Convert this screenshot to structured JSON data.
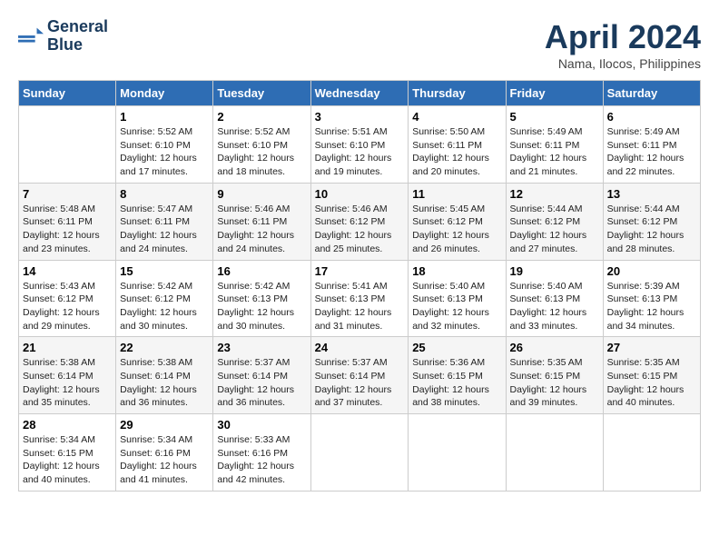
{
  "header": {
    "logo_line1": "General",
    "logo_line2": "Blue",
    "month_title": "April 2024",
    "location": "Nama, Ilocos, Philippines"
  },
  "days_of_week": [
    "Sunday",
    "Monday",
    "Tuesday",
    "Wednesday",
    "Thursday",
    "Friday",
    "Saturday"
  ],
  "weeks": [
    [
      {
        "num": "",
        "sunrise": "",
        "sunset": "",
        "daylight": ""
      },
      {
        "num": "1",
        "sunrise": "Sunrise: 5:52 AM",
        "sunset": "Sunset: 6:10 PM",
        "daylight": "Daylight: 12 hours and 17 minutes."
      },
      {
        "num": "2",
        "sunrise": "Sunrise: 5:52 AM",
        "sunset": "Sunset: 6:10 PM",
        "daylight": "Daylight: 12 hours and 18 minutes."
      },
      {
        "num": "3",
        "sunrise": "Sunrise: 5:51 AM",
        "sunset": "Sunset: 6:10 PM",
        "daylight": "Daylight: 12 hours and 19 minutes."
      },
      {
        "num": "4",
        "sunrise": "Sunrise: 5:50 AM",
        "sunset": "Sunset: 6:11 PM",
        "daylight": "Daylight: 12 hours and 20 minutes."
      },
      {
        "num": "5",
        "sunrise": "Sunrise: 5:49 AM",
        "sunset": "Sunset: 6:11 PM",
        "daylight": "Daylight: 12 hours and 21 minutes."
      },
      {
        "num": "6",
        "sunrise": "Sunrise: 5:49 AM",
        "sunset": "Sunset: 6:11 PM",
        "daylight": "Daylight: 12 hours and 22 minutes."
      }
    ],
    [
      {
        "num": "7",
        "sunrise": "Sunrise: 5:48 AM",
        "sunset": "Sunset: 6:11 PM",
        "daylight": "Daylight: 12 hours and 23 minutes."
      },
      {
        "num": "8",
        "sunrise": "Sunrise: 5:47 AM",
        "sunset": "Sunset: 6:11 PM",
        "daylight": "Daylight: 12 hours and 24 minutes."
      },
      {
        "num": "9",
        "sunrise": "Sunrise: 5:46 AM",
        "sunset": "Sunset: 6:11 PM",
        "daylight": "Daylight: 12 hours and 24 minutes."
      },
      {
        "num": "10",
        "sunrise": "Sunrise: 5:46 AM",
        "sunset": "Sunset: 6:12 PM",
        "daylight": "Daylight: 12 hours and 25 minutes."
      },
      {
        "num": "11",
        "sunrise": "Sunrise: 5:45 AM",
        "sunset": "Sunset: 6:12 PM",
        "daylight": "Daylight: 12 hours and 26 minutes."
      },
      {
        "num": "12",
        "sunrise": "Sunrise: 5:44 AM",
        "sunset": "Sunset: 6:12 PM",
        "daylight": "Daylight: 12 hours and 27 minutes."
      },
      {
        "num": "13",
        "sunrise": "Sunrise: 5:44 AM",
        "sunset": "Sunset: 6:12 PM",
        "daylight": "Daylight: 12 hours and 28 minutes."
      }
    ],
    [
      {
        "num": "14",
        "sunrise": "Sunrise: 5:43 AM",
        "sunset": "Sunset: 6:12 PM",
        "daylight": "Daylight: 12 hours and 29 minutes."
      },
      {
        "num": "15",
        "sunrise": "Sunrise: 5:42 AM",
        "sunset": "Sunset: 6:12 PM",
        "daylight": "Daylight: 12 hours and 30 minutes."
      },
      {
        "num": "16",
        "sunrise": "Sunrise: 5:42 AM",
        "sunset": "Sunset: 6:13 PM",
        "daylight": "Daylight: 12 hours and 30 minutes."
      },
      {
        "num": "17",
        "sunrise": "Sunrise: 5:41 AM",
        "sunset": "Sunset: 6:13 PM",
        "daylight": "Daylight: 12 hours and 31 minutes."
      },
      {
        "num": "18",
        "sunrise": "Sunrise: 5:40 AM",
        "sunset": "Sunset: 6:13 PM",
        "daylight": "Daylight: 12 hours and 32 minutes."
      },
      {
        "num": "19",
        "sunrise": "Sunrise: 5:40 AM",
        "sunset": "Sunset: 6:13 PM",
        "daylight": "Daylight: 12 hours and 33 minutes."
      },
      {
        "num": "20",
        "sunrise": "Sunrise: 5:39 AM",
        "sunset": "Sunset: 6:13 PM",
        "daylight": "Daylight: 12 hours and 34 minutes."
      }
    ],
    [
      {
        "num": "21",
        "sunrise": "Sunrise: 5:38 AM",
        "sunset": "Sunset: 6:14 PM",
        "daylight": "Daylight: 12 hours and 35 minutes."
      },
      {
        "num": "22",
        "sunrise": "Sunrise: 5:38 AM",
        "sunset": "Sunset: 6:14 PM",
        "daylight": "Daylight: 12 hours and 36 minutes."
      },
      {
        "num": "23",
        "sunrise": "Sunrise: 5:37 AM",
        "sunset": "Sunset: 6:14 PM",
        "daylight": "Daylight: 12 hours and 36 minutes."
      },
      {
        "num": "24",
        "sunrise": "Sunrise: 5:37 AM",
        "sunset": "Sunset: 6:14 PM",
        "daylight": "Daylight: 12 hours and 37 minutes."
      },
      {
        "num": "25",
        "sunrise": "Sunrise: 5:36 AM",
        "sunset": "Sunset: 6:15 PM",
        "daylight": "Daylight: 12 hours and 38 minutes."
      },
      {
        "num": "26",
        "sunrise": "Sunrise: 5:35 AM",
        "sunset": "Sunset: 6:15 PM",
        "daylight": "Daylight: 12 hours and 39 minutes."
      },
      {
        "num": "27",
        "sunrise": "Sunrise: 5:35 AM",
        "sunset": "Sunset: 6:15 PM",
        "daylight": "Daylight: 12 hours and 40 minutes."
      }
    ],
    [
      {
        "num": "28",
        "sunrise": "Sunrise: 5:34 AM",
        "sunset": "Sunset: 6:15 PM",
        "daylight": "Daylight: 12 hours and 40 minutes."
      },
      {
        "num": "29",
        "sunrise": "Sunrise: 5:34 AM",
        "sunset": "Sunset: 6:16 PM",
        "daylight": "Daylight: 12 hours and 41 minutes."
      },
      {
        "num": "30",
        "sunrise": "Sunrise: 5:33 AM",
        "sunset": "Sunset: 6:16 PM",
        "daylight": "Daylight: 12 hours and 42 minutes."
      },
      {
        "num": "",
        "sunrise": "",
        "sunset": "",
        "daylight": ""
      },
      {
        "num": "",
        "sunrise": "",
        "sunset": "",
        "daylight": ""
      },
      {
        "num": "",
        "sunrise": "",
        "sunset": "",
        "daylight": ""
      },
      {
        "num": "",
        "sunrise": "",
        "sunset": "",
        "daylight": ""
      }
    ]
  ]
}
